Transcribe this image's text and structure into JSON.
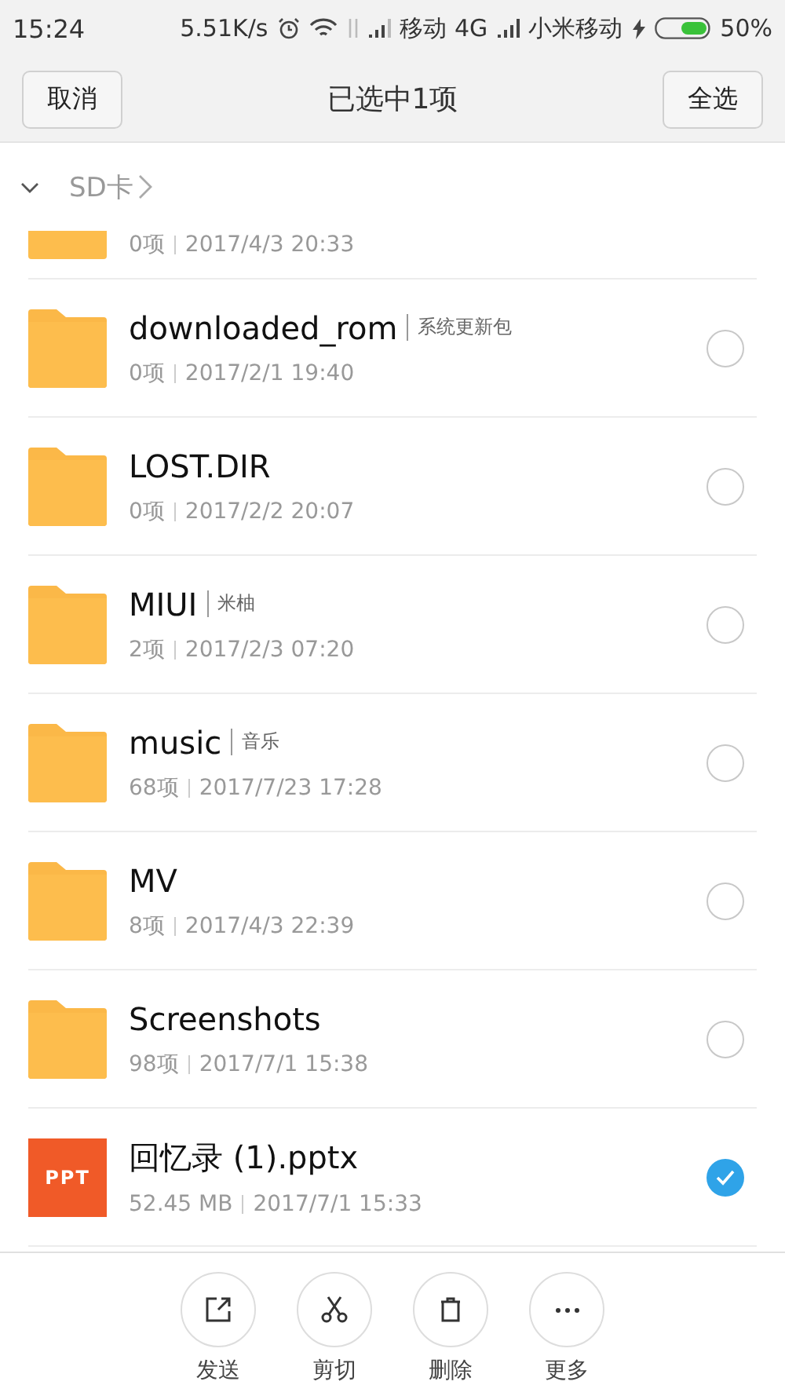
{
  "status_bar": {
    "time": "15:24",
    "speed": "5.51K/s",
    "carrier_1": "移动 4G",
    "carrier_2": "小米移动",
    "battery": "50%"
  },
  "header": {
    "cancel": "取消",
    "title": "已选中1项",
    "select_all": "全选"
  },
  "breadcrumb": {
    "path": "SD卡"
  },
  "files": [
    {
      "kind": "partial",
      "meta_count": "0项",
      "meta_date": "2017/4/3 20:33"
    },
    {
      "kind": "folder",
      "name": "downloaded_rom",
      "tag": "系统更新包",
      "meta_count": "0项",
      "meta_date": "2017/2/1 19:40",
      "selected": false
    },
    {
      "kind": "folder",
      "name": "LOST.DIR",
      "meta_count": "0项",
      "meta_date": "2017/2/2 20:07",
      "selected": false
    },
    {
      "kind": "folder",
      "name": "MIUI",
      "tag": "米柚",
      "meta_count": "2项",
      "meta_date": "2017/2/3 07:20",
      "selected": false
    },
    {
      "kind": "folder",
      "name": "music",
      "tag": "音乐",
      "meta_count": "68项",
      "meta_date": "2017/7/23 17:28",
      "selected": false
    },
    {
      "kind": "folder",
      "name": "MV",
      "meta_count": "8项",
      "meta_date": "2017/4/3 22:39",
      "selected": false
    },
    {
      "kind": "folder",
      "name": "Screenshots",
      "meta_count": "98项",
      "meta_date": "2017/7/1 15:38",
      "selected": false
    },
    {
      "kind": "ppt",
      "icon_label": "PPT",
      "name": "回忆录 (1).pptx",
      "meta_count": "52.45 MB",
      "meta_date": "2017/7/1 15:33",
      "selected": true
    }
  ],
  "actions": [
    {
      "kind": "send",
      "label": "发送"
    },
    {
      "kind": "cut",
      "label": "剪切"
    },
    {
      "kind": "delete",
      "label": "删除"
    },
    {
      "kind": "more",
      "label": "更多"
    }
  ]
}
